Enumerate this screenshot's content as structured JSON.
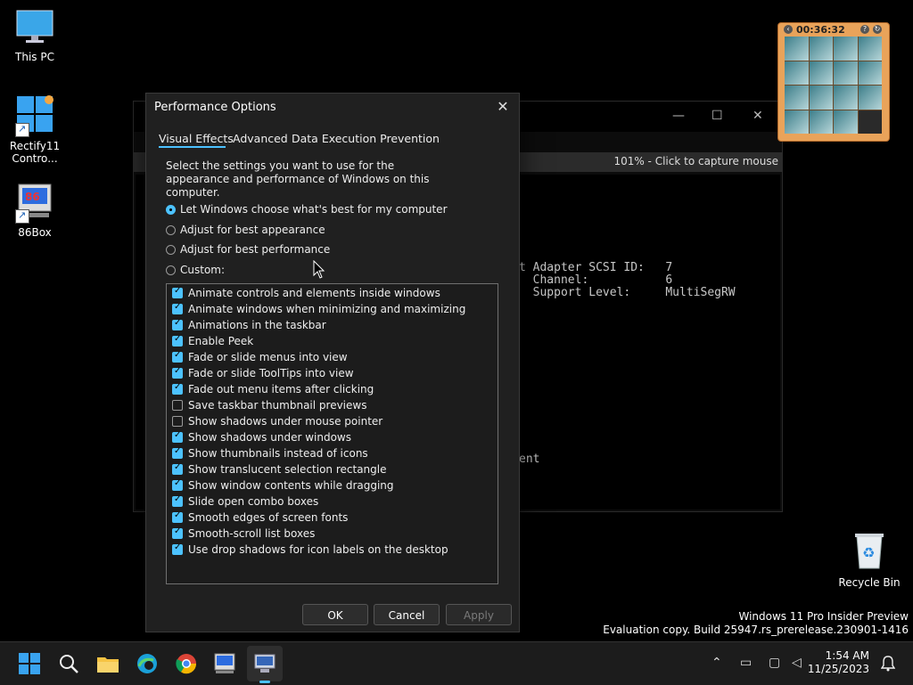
{
  "desktop": {
    "icons": [
      {
        "label": "This PC"
      },
      {
        "label": "Rectify11 Contro..."
      },
      {
        "label": "86Box"
      },
      {
        "label": "Recycle Bin"
      }
    ]
  },
  "background_window": {
    "status": "101% - Click to capture mouse",
    "screen_lines": [
      "t Adapter SCSI ID:   7",
      "  Channel:           6",
      "  Support Level:     MultiSegRW",
      "ent"
    ]
  },
  "puzzle": {
    "time": "00:36:32"
  },
  "dialog": {
    "title": "Performance Options",
    "close_glyph": "✕",
    "tabs": [
      "Visual Effects",
      "Advanced",
      "Data Execution Prevention"
    ],
    "description": "Select the settings you want to use for the appearance and performance of Windows on this computer.",
    "options": [
      {
        "label": "Let Windows choose what's best for my computer",
        "selected": true
      },
      {
        "label": "Adjust for best appearance",
        "selected": false
      },
      {
        "label": "Adjust for best performance",
        "selected": false
      },
      {
        "label": "Custom:",
        "selected": false
      }
    ],
    "effects": [
      {
        "label": "Animate controls and elements inside windows",
        "checked": true
      },
      {
        "label": "Animate windows when minimizing and maximizing",
        "checked": true
      },
      {
        "label": "Animations in the taskbar",
        "checked": true
      },
      {
        "label": "Enable Peek",
        "checked": true
      },
      {
        "label": "Fade or slide menus into view",
        "checked": true
      },
      {
        "label": "Fade or slide ToolTips into view",
        "checked": true
      },
      {
        "label": "Fade out menu items after clicking",
        "checked": true
      },
      {
        "label": "Save taskbar thumbnail previews",
        "checked": false
      },
      {
        "label": "Show shadows under mouse pointer",
        "checked": false
      },
      {
        "label": "Show shadows under windows",
        "checked": true
      },
      {
        "label": "Show thumbnails instead of icons",
        "checked": true
      },
      {
        "label": "Show translucent selection rectangle",
        "checked": true
      },
      {
        "label": "Show window contents while dragging",
        "checked": true
      },
      {
        "label": "Slide open combo boxes",
        "checked": true
      },
      {
        "label": "Smooth edges of screen fonts",
        "checked": true
      },
      {
        "label": "Smooth-scroll list boxes",
        "checked": true
      },
      {
        "label": "Use drop shadows for icon labels on the desktop",
        "checked": true
      }
    ],
    "buttons": {
      "ok": "OK",
      "cancel": "Cancel",
      "apply": "Apply"
    }
  },
  "watermark": {
    "line1": "Windows 11 Pro Insider Preview",
    "line2": "Evaluation copy. Build 25947.rs_prerelease.230901-1416"
  },
  "taskbar": {
    "time": "1:54 AM",
    "date": "11/25/2023"
  }
}
